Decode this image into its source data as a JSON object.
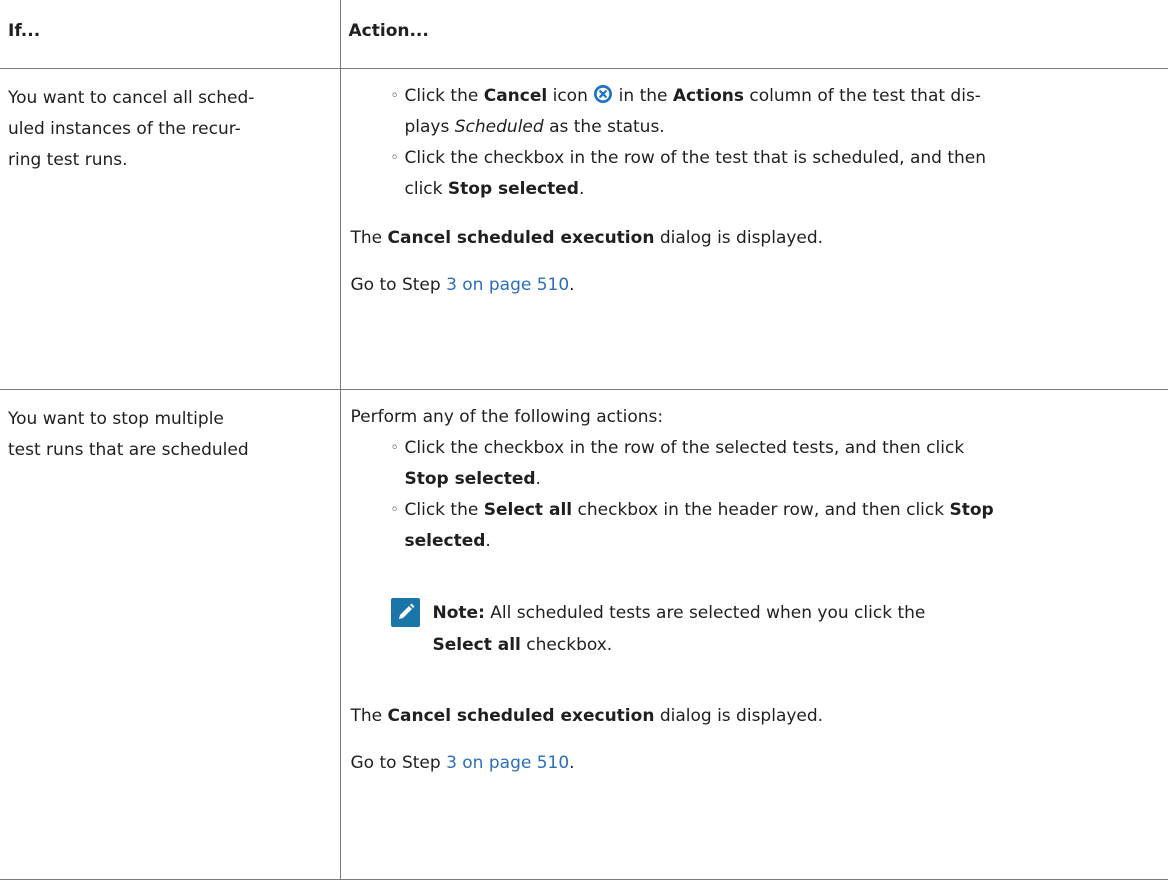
{
  "header": {
    "col_if": "If...",
    "col_action": "Action..."
  },
  "row1": {
    "if_lines": [
      "You want to cancel all sched-",
      "uled instances of the recur-",
      "ring test runs."
    ],
    "bullet1": {
      "line1_pre": "Click the ",
      "line1_bold1": "Cancel",
      "line1_mid": " icon ",
      "line1_post_icon": " in the ",
      "line1_bold2": "Actions",
      "line1_tail": " column of the test that dis-",
      "line2_pre": "plays ",
      "line2_italic": "Scheduled",
      "line2_tail": " as the status."
    },
    "bullet2": {
      "line1": "Click the checkbox in the row of the test that is scheduled, and then",
      "line2_pre": "click ",
      "line2_bold": "Stop selected",
      "line2_tail": "."
    },
    "dialog_pre": "The ",
    "dialog_bold": "Cancel scheduled execution",
    "dialog_tail": " dialog is displayed.",
    "goto_pre": "Go to Step ",
    "goto_link": "3 on page 510",
    "goto_tail": "."
  },
  "row2": {
    "if_lines": [
      "You want to stop multiple",
      "test runs that are scheduled"
    ],
    "intro": "Perform any of the following actions:",
    "bullet1": {
      "line1": "Click the checkbox in the row of the selected tests, and then click",
      "line2_bold": "Stop selected",
      "line2_tail": "."
    },
    "bullet2": {
      "line1_pre": "Click the ",
      "line1_bold1": "Select all",
      "line1_mid": " checkbox in the header row, and then click ",
      "line1_bold2": "Stop",
      "line2_bold": "selected",
      "line2_tail": "."
    },
    "note": {
      "label": "Note:",
      "line1_tail": " All scheduled tests are selected when you click the",
      "line2_bold": "Select all",
      "line2_tail": " checkbox."
    },
    "dialog_pre": "The ",
    "dialog_bold": "Cancel scheduled execution",
    "dialog_tail": " dialog is displayed.",
    "goto_pre": "Go to Step ",
    "goto_link": "3 on page 510",
    "goto_tail": "."
  },
  "colors": {
    "link": "#2b6fb6",
    "note_icon": "#1a75a8",
    "cancel_icon": "#1f72c4",
    "border": "#7a7a7a"
  },
  "icons": {
    "cancel": "cancel-circle-x-icon",
    "note": "note-pencil-icon"
  }
}
